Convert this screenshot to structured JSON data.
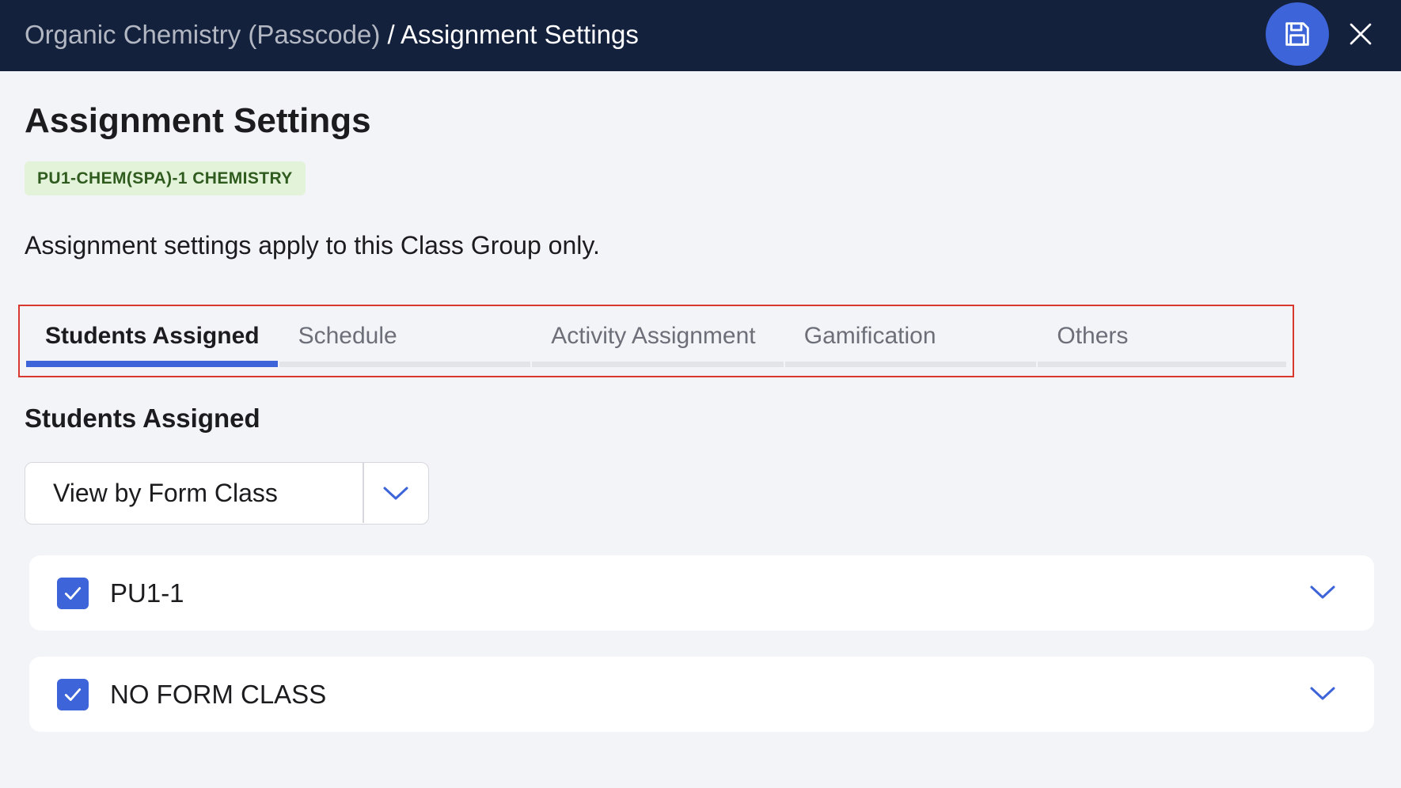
{
  "header": {
    "breadcrumb_parent": "Organic Chemistry (Passcode)",
    "breadcrumb_separator": " / ",
    "breadcrumb_current": "Assignment Settings",
    "save_icon": "floppy-disk-icon",
    "close_icon": "close-icon"
  },
  "page": {
    "title": "Assignment Settings",
    "class_group_badge": "PU1-CHEM(SPA)-1 CHEMISTRY",
    "description": "Assignment settings apply to this Class Group only."
  },
  "tabs": [
    {
      "label": "Students Assigned",
      "active": true
    },
    {
      "label": "Schedule",
      "active": false
    },
    {
      "label": "Activity Assignment",
      "active": false
    },
    {
      "label": "Gamification",
      "active": false
    },
    {
      "label": "Others",
      "active": false
    }
  ],
  "students_assigned": {
    "heading": "Students Assigned",
    "view_select": {
      "selected": "View by Form Class",
      "icon": "chevron-down-icon"
    },
    "form_classes": [
      {
        "label": "PU1-1",
        "checked": true
      },
      {
        "label": "NO FORM CLASS",
        "checked": true
      }
    ]
  },
  "colors": {
    "header_bg": "#13213d",
    "accent": "#3d64d8",
    "badge_bg": "#e3f3d9",
    "badge_text": "#2f5b1e",
    "highlight_border": "#d9382f",
    "page_bg": "#f3f4f8"
  }
}
